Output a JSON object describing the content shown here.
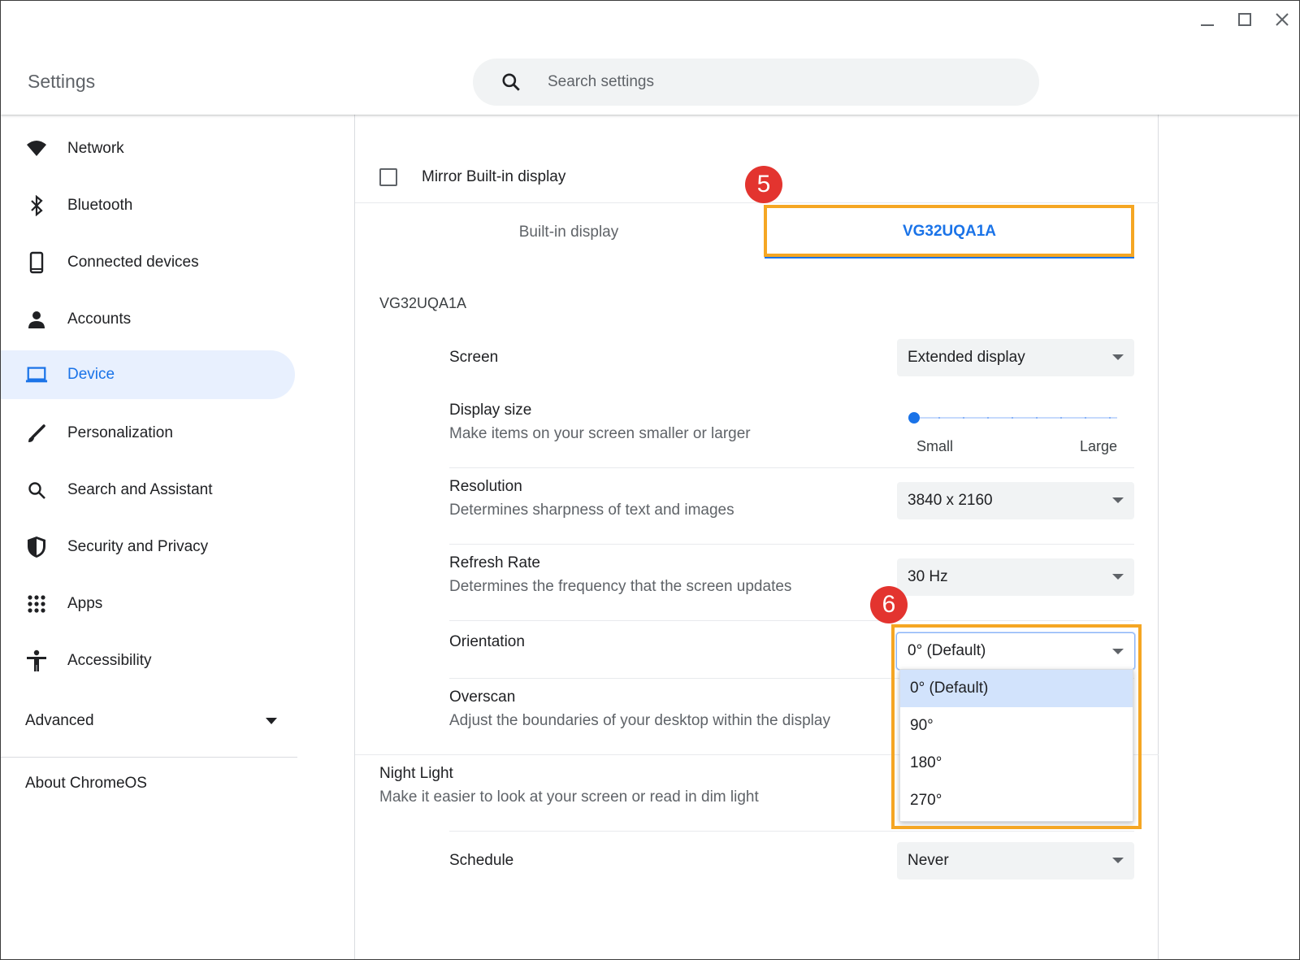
{
  "app": {
    "title": "Settings"
  },
  "search": {
    "placeholder": "Search settings"
  },
  "sidebar": {
    "items": [
      {
        "label": "Network",
        "icon": "wifi-icon"
      },
      {
        "label": "Bluetooth",
        "icon": "bluetooth-icon"
      },
      {
        "label": "Connected devices",
        "icon": "phone-icon"
      },
      {
        "label": "Accounts",
        "icon": "person-icon"
      },
      {
        "label": "Device",
        "icon": "laptop-icon",
        "active": true
      },
      {
        "label": "Personalization",
        "icon": "brush-icon"
      },
      {
        "label": "Search and Assistant",
        "icon": "search-icon"
      },
      {
        "label": "Security and Privacy",
        "icon": "shield-icon"
      },
      {
        "label": "Apps",
        "icon": "apps-grid-icon"
      },
      {
        "label": "Accessibility",
        "icon": "accessibility-icon"
      }
    ],
    "advanced": "Advanced",
    "about": "About ChromeOS"
  },
  "display": {
    "mirror_label": "Mirror Built-in display",
    "mirror_checked": false,
    "tabs": [
      "Built-in display",
      "VG32UQA1A"
    ],
    "active_tab": 1,
    "section_title": "VG32UQA1A",
    "screen": {
      "label": "Screen",
      "value": "Extended display"
    },
    "display_size": {
      "label": "Display size",
      "sub": "Make items on your screen smaller or larger",
      "min_label": "Small",
      "max_label": "Large",
      "level": 0
    },
    "resolution": {
      "label": "Resolution",
      "sub": "Determines sharpness of text and images",
      "value": "3840 x 2160"
    },
    "refresh": {
      "label": "Refresh Rate",
      "sub": "Determines the frequency that the screen updates",
      "value": "30 Hz"
    },
    "orientation": {
      "label": "Orientation",
      "value": "0° (Default)",
      "options": [
        "0° (Default)",
        "90°",
        "180°",
        "270°"
      ],
      "selected": 0
    },
    "overscan": {
      "label": "Overscan",
      "sub": "Adjust the boundaries of your desktop within the display"
    },
    "night_light": {
      "label": "Night Light",
      "sub": "Make it easier to look at your screen or read in dim light"
    },
    "schedule": {
      "label": "Schedule",
      "value": "Never"
    }
  },
  "annotations": {
    "step_tab": "5",
    "step_orientation": "6",
    "highlight_color": "#f5a623",
    "badge_color": "#e3342f"
  },
  "colors": {
    "accent": "#1a73e8",
    "active_bg": "#e8f0fe"
  }
}
